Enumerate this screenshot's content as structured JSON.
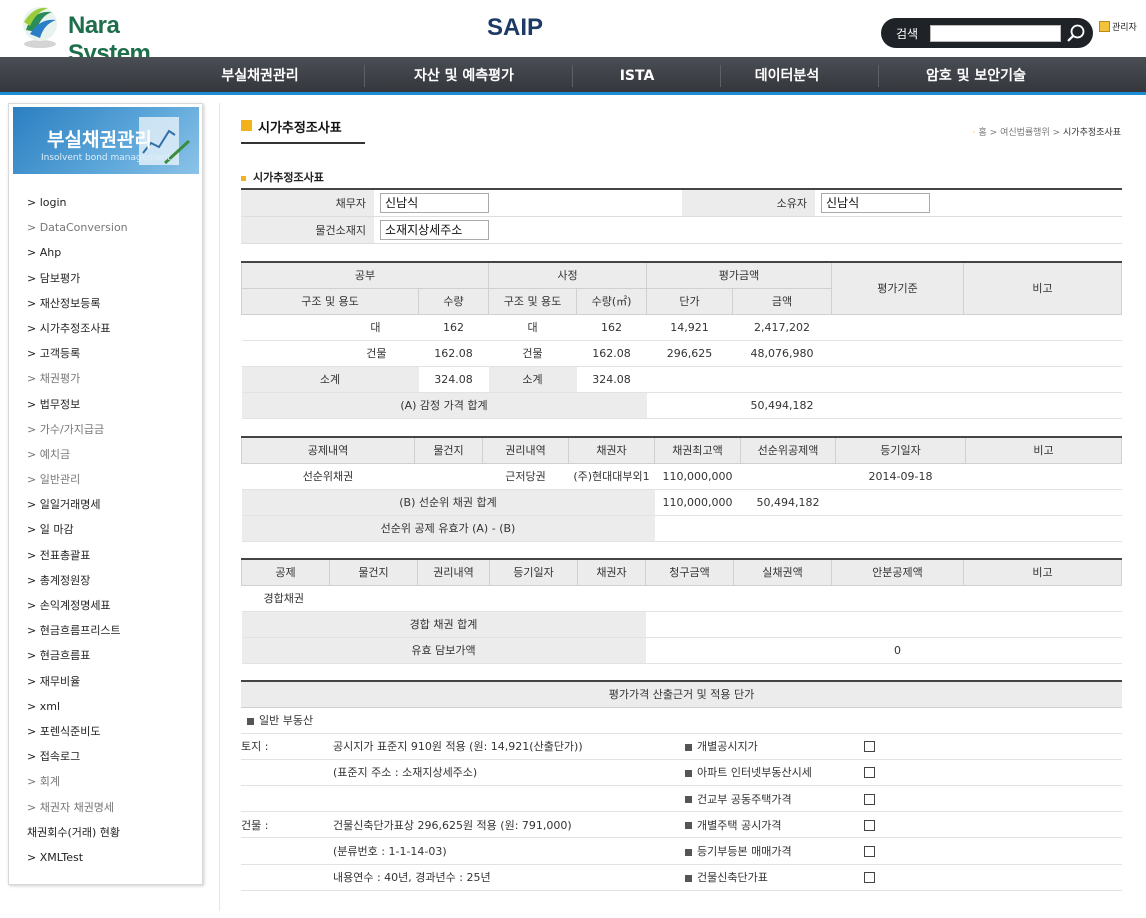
{
  "header": {
    "logo_text": "Nara System",
    "site_title": "SAIP",
    "search_label": "검색",
    "search_value": "",
    "admin_label": "관리자"
  },
  "nav": [
    "부실채권관리",
    "자산 및 예측평가",
    "ISTA",
    "데이터분석",
    "암호 및 보안기술"
  ],
  "sidebar": {
    "banner_title": "부실채권관리",
    "banner_sub": "Insolvent bond management",
    "items": [
      "> login",
      "> DataConversion",
      "> Ahp",
      "> 담보평가",
      "> 재산정보등록",
      "> 시가추정조사표",
      "> 고객등록",
      "> 채권평가",
      "> 법무정보",
      "> 가수/가지급금",
      "> 예치금",
      "> 일반관리",
      "> 일일거래명세",
      "> 일 마감",
      "> 전표총괄표",
      "> 총계정원장",
      "> 손익계정명세표",
      "> 현금흐름프리스트",
      "> 현금흐름표",
      "> 재무비율",
      "> xml",
      "> 포렌식준비도",
      "> 접속로그",
      "> 회계",
      "> 채권자 채권명세",
      "채권회수(거래) 현황",
      "> XMLTest"
    ]
  },
  "page": {
    "title": "시가추정조사표",
    "breadcrumb": [
      "홈",
      "여신법률행위",
      "시가추정조사표"
    ],
    "section_title": "시가추정조사표"
  },
  "owner": {
    "debtor_label": "채무자",
    "debtor_value": "신남식",
    "owner_label": "소유자",
    "owner_value": "신남식",
    "location_label": "물건소재지",
    "location_value": "소재지상세주소"
  },
  "table1": {
    "group_headers": [
      "공부",
      "사정",
      "평가금액",
      "평가기준",
      "비고"
    ],
    "sub_headers": [
      "구조 및 용도",
      "수량",
      "구조 및 용도",
      "수량(㎡)",
      "단가",
      "금액"
    ],
    "rows": [
      [
        "대",
        "162",
        "대",
        "162",
        "14,921",
        "2,417,202"
      ],
      [
        "건물",
        "162.08",
        "건물",
        "162.08",
        "296,625",
        "48,076,980"
      ]
    ],
    "subtotal_label": "소계",
    "subtotal_qty1": "324.08",
    "subtotal_label2": "소계",
    "subtotal_qty2": "324.08",
    "total_label": "(A) 감정 가격 합계",
    "total_value": "50,494,182"
  },
  "table2": {
    "headers": [
      "공제내역",
      "물건지",
      "권리내역",
      "채권자",
      "채권최고액",
      "선순위공제액",
      "등기일자",
      "비고"
    ],
    "row": [
      "선순위채권",
      "",
      "근저당권",
      "(주)현대대부외1",
      "110,000,000",
      "",
      "2014-09-18",
      ""
    ],
    "sum_label": "(B) 선순위 채권 합계",
    "sum_max": "110,000,000",
    "sum_deduct": "50,494,182",
    "effective_label": "선순위 공제 유효가 (A) - (B)"
  },
  "table3": {
    "headers": [
      "공제",
      "물건지",
      "권리내역",
      "등기일자",
      "채권자",
      "청구금액",
      "실채권액",
      "안분공제액",
      "비고"
    ],
    "row_label": "경합채권",
    "sum_label": "경합 채권 합계",
    "collateral_label": "유효 담보가액",
    "collateral_value": "0"
  },
  "table4": {
    "title": "평가가격 산출근거 및 적용 단가",
    "category": "일반 부동산",
    "rows": [
      {
        "prefix": "토지 :",
        "text": "공시지가 표준지 910원 적용 (원: 14,921(산출단가))",
        "option": "개별공시지가"
      },
      {
        "prefix": "",
        "text": "(표준지 주소 : 소재지상세주소)",
        "option": "아파트 인터넷부동산시세"
      },
      {
        "prefix": "",
        "text": "",
        "option": "건교부 공동주택가격"
      },
      {
        "prefix": "건물 :",
        "text": "건물신축단가표상 296,625원 적용 (원: 791,000)",
        "option": "개별주택 공시가격"
      },
      {
        "prefix": "",
        "text": "(분류번호 : 1-1-14-03)",
        "option": "등기부등본 매매가격"
      },
      {
        "prefix": "",
        "text": "내용연수 : 40년, 경과년수 : 25년",
        "option": "건물신축단가표"
      }
    ]
  }
}
